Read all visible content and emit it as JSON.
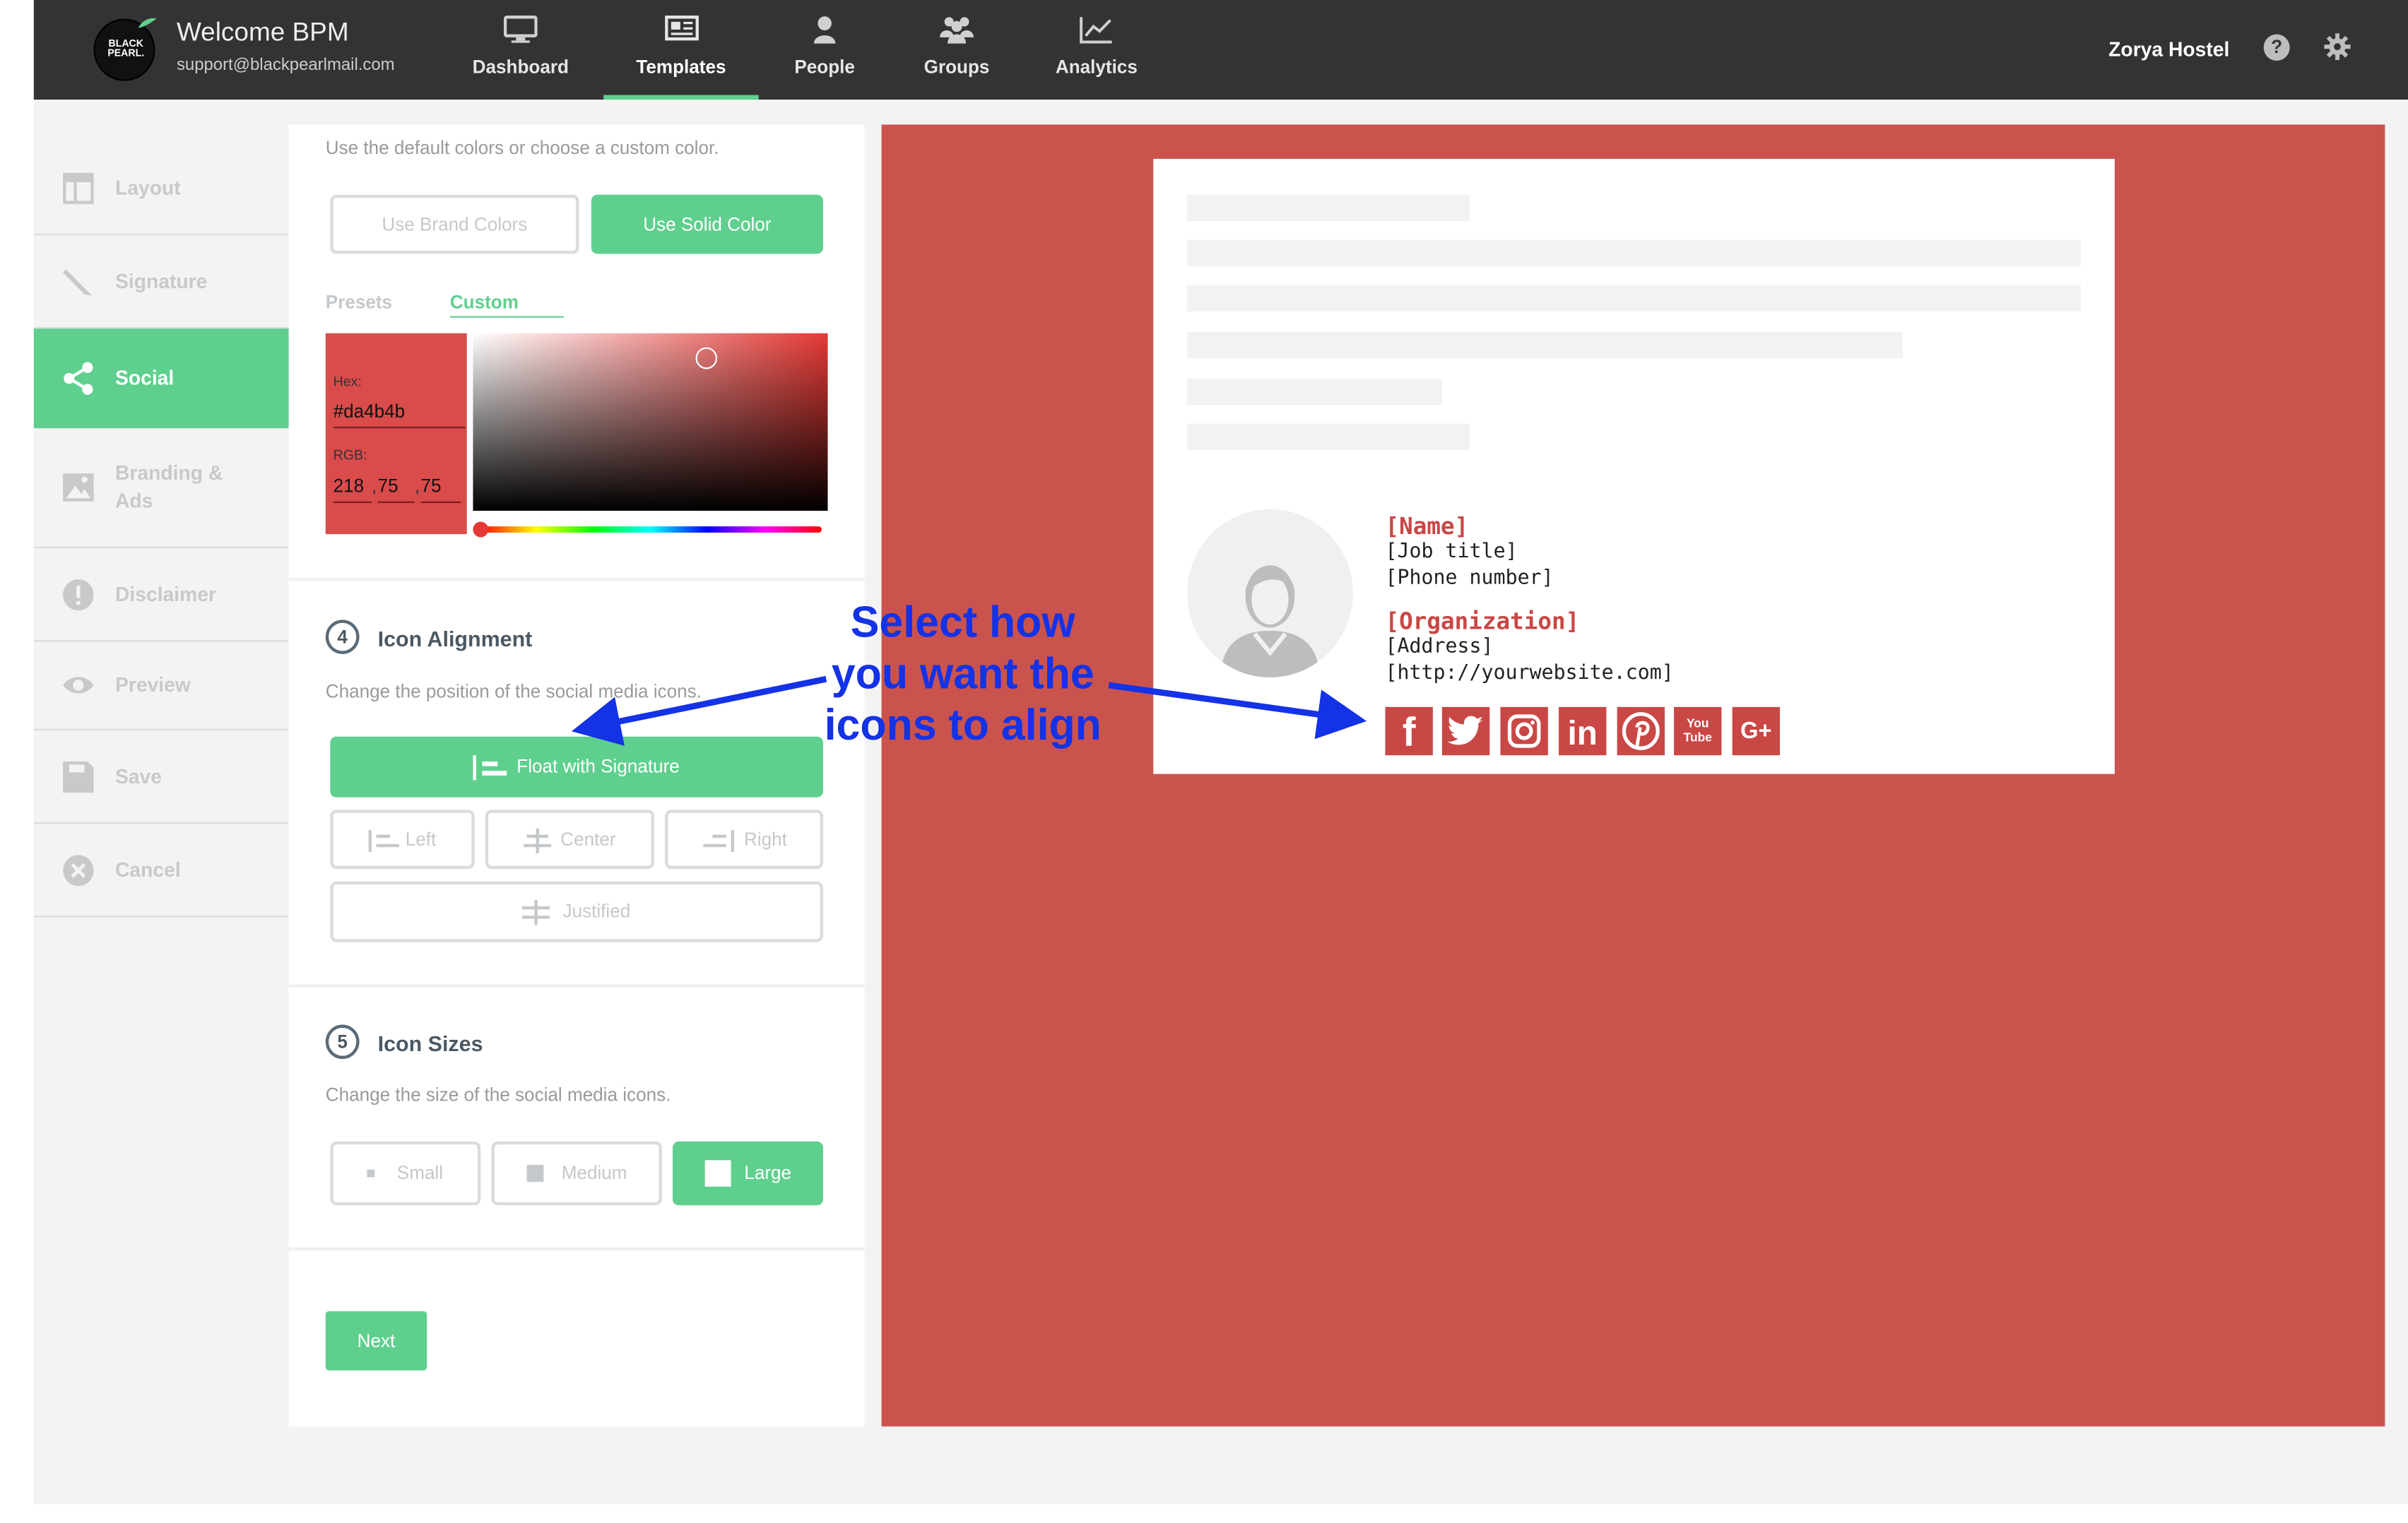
{
  "header": {
    "logo_text": "BLACK PEARL.",
    "welcome": "Welcome BPM",
    "email": "support@blackpearlmail.com",
    "nav": [
      {
        "label": "Dashboard",
        "icon": "monitor-icon"
      },
      {
        "label": "Templates",
        "icon": "templates-icon",
        "active": true
      },
      {
        "label": "People",
        "icon": "person-icon"
      },
      {
        "label": "Groups",
        "icon": "group-icon"
      },
      {
        "label": "Analytics",
        "icon": "chart-icon"
      }
    ],
    "org_name": "Zorya Hostel",
    "help_glyph": "?"
  },
  "sidebar": {
    "items": [
      {
        "label": "Layout",
        "icon": "layout-icon"
      },
      {
        "label": "Signature",
        "icon": "pencil-icon"
      },
      {
        "label": "Social",
        "icon": "share-icon",
        "active": true
      },
      {
        "label": "Branding & Ads",
        "icon": "image-icon"
      },
      {
        "label": "Disclaimer",
        "icon": "alert-icon"
      },
      {
        "label": "Preview",
        "icon": "eye-icon"
      },
      {
        "label": "Save",
        "icon": "save-icon"
      },
      {
        "label": "Cancel",
        "icon": "cancel-icon"
      }
    ]
  },
  "color_section": {
    "hint": "Use the default colors or choose a custom color.",
    "brand_button": "Use Brand Colors",
    "solid_button": "Use Solid Color",
    "tabs": [
      "Presets",
      "Custom"
    ],
    "hex_label": "Hex:",
    "hex_value": "#da4b4b",
    "rgb_label": "RGB:",
    "r": "218",
    "g": "75",
    "b": "75",
    "comma": ","
  },
  "alignment": {
    "step": "4",
    "title": "Icon Alignment",
    "hint": "Change the position of the social media icons.",
    "float": "Float with Signature",
    "left": "Left",
    "center": "Center",
    "right": "Right",
    "justified": "Justified"
  },
  "sizes": {
    "step": "5",
    "title": "Icon Sizes",
    "hint": "Change the size of the social media icons.",
    "small": "Small",
    "medium": "Medium",
    "large": "Large"
  },
  "next_button": "Next",
  "signature": {
    "name": "[Name]",
    "job_title": "[Job title]",
    "phone": "[Phone number]",
    "organization": "[Organization]",
    "address": "[Address]",
    "website": "[http://yourwebsite.com]",
    "social_icons": [
      {
        "icon": "facebook-icon",
        "glyph": "f"
      },
      {
        "icon": "twitter-icon",
        "glyph": ""
      },
      {
        "icon": "instagram-icon",
        "glyph": ""
      },
      {
        "icon": "linkedin-icon",
        "glyph": "in"
      },
      {
        "icon": "pinterest-icon",
        "glyph": "P"
      },
      {
        "icon": "youtube-icon",
        "glyph": "You Tube"
      },
      {
        "icon": "google-plus-icon",
        "glyph": "G+"
      }
    ]
  },
  "annotation": {
    "line1": "Select how",
    "line2": "you want the",
    "line3": "icons to align"
  },
  "colors": {
    "accent": "#5fcf8e",
    "topbar": "#333333",
    "preview_bg": "#cb534e",
    "brand_red": "#da4b4b",
    "annotation": "#1432e6"
  }
}
